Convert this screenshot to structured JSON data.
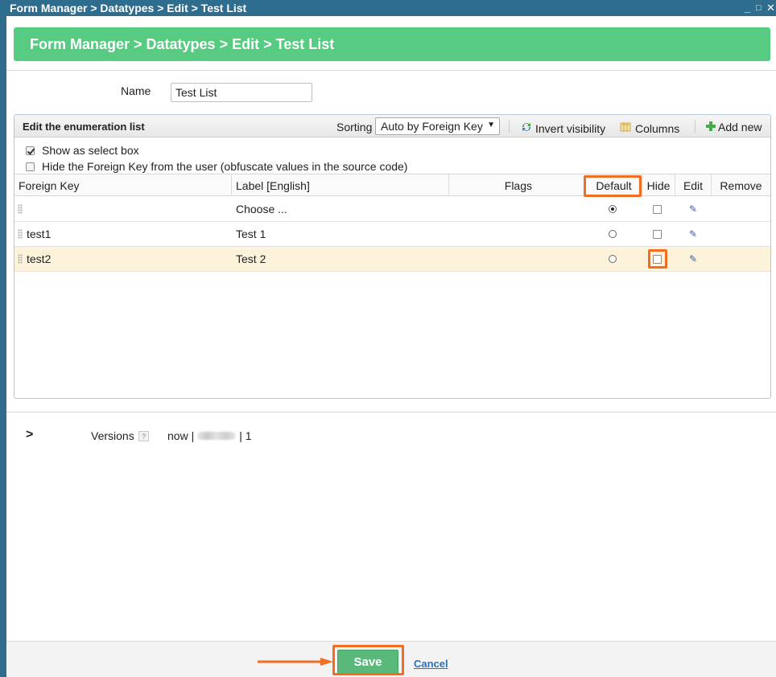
{
  "window": {
    "title": "Form Manager > Datatypes > Edit > Test List",
    "minimize_glyph": "_",
    "maximize_glyph": "□",
    "close_glyph": "✕"
  },
  "header": {
    "breadcrumb": "Form Manager > Datatypes > Edit > Test List"
  },
  "form": {
    "name_label": "Name",
    "name_value": "Test List"
  },
  "panel": {
    "title": "Edit the enumeration list",
    "sorting_label": "Sorting",
    "sorting_value": "Auto by Foreign Key",
    "invert_visibility": "Invert visibility",
    "columns": "Columns",
    "add_new": "Add new"
  },
  "options": {
    "show_as_select": {
      "label": "Show as select box",
      "checked": true
    },
    "hide_foreign_key": {
      "label": "Hide the Foreign Key from the user (obfuscate values in the source code)",
      "checked": false
    }
  },
  "table": {
    "columns": [
      "Foreign Key",
      "Label [English]",
      "Flags",
      "Default",
      "Hide",
      "Edit",
      "Remove"
    ],
    "rows": [
      {
        "key": "",
        "label": "Choose ...",
        "flags": "",
        "default": true,
        "hide": false,
        "selected": false
      },
      {
        "key": "test1",
        "label": "Test 1",
        "flags": "",
        "default": false,
        "hide": false,
        "selected": false
      },
      {
        "key": "test2",
        "label": "Test 2",
        "flags": "",
        "default": false,
        "hide": false,
        "selected": true
      }
    ]
  },
  "versions": {
    "toggle_glyph": ">",
    "label": "Versions",
    "help": "?",
    "now": "now |",
    "count": "| 1"
  },
  "footer": {
    "save": "Save",
    "cancel": "Cancel"
  },
  "icons": {
    "drag_handle": "drag-handle-icon",
    "edit": "pencil-icon",
    "invert": "refresh-icon",
    "columns": "columns-icon",
    "add": "plus-icon"
  },
  "colors": {
    "title_bar": "#2f6d8f",
    "banner": "#57cb81",
    "save": "#59b97a",
    "highlight": "#f26d21",
    "selected_row": "#fdf3da",
    "link": "#2a72b5"
  }
}
